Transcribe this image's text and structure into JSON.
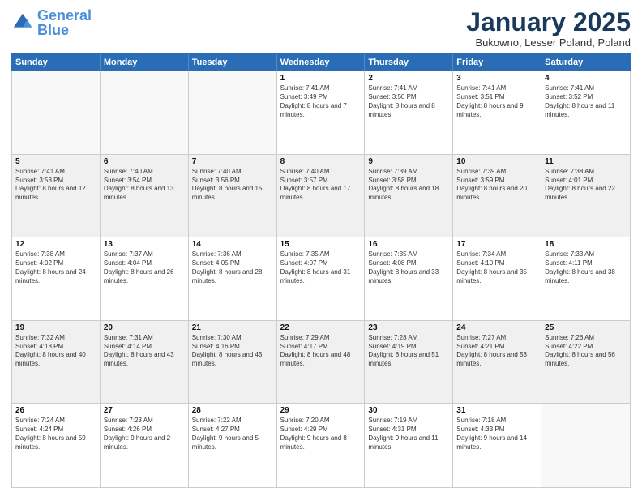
{
  "header": {
    "logo_general": "General",
    "logo_blue": "Blue",
    "month_title": "January 2025",
    "location": "Bukowno, Lesser Poland, Poland"
  },
  "days_of_week": [
    "Sunday",
    "Monday",
    "Tuesday",
    "Wednesday",
    "Thursday",
    "Friday",
    "Saturday"
  ],
  "weeks": [
    [
      {
        "day": "",
        "empty": true
      },
      {
        "day": "",
        "empty": true
      },
      {
        "day": "",
        "empty": true
      },
      {
        "day": "1",
        "sunrise": "7:41 AM",
        "sunset": "3:49 PM",
        "daylight": "8 hours and 7 minutes."
      },
      {
        "day": "2",
        "sunrise": "7:41 AM",
        "sunset": "3:50 PM",
        "daylight": "8 hours and 8 minutes."
      },
      {
        "day": "3",
        "sunrise": "7:41 AM",
        "sunset": "3:51 PM",
        "daylight": "8 hours and 9 minutes."
      },
      {
        "day": "4",
        "sunrise": "7:41 AM",
        "sunset": "3:52 PM",
        "daylight": "8 hours and 11 minutes."
      }
    ],
    [
      {
        "day": "5",
        "sunrise": "7:41 AM",
        "sunset": "3:53 PM",
        "daylight": "8 hours and 12 minutes."
      },
      {
        "day": "6",
        "sunrise": "7:40 AM",
        "sunset": "3:54 PM",
        "daylight": "8 hours and 13 minutes."
      },
      {
        "day": "7",
        "sunrise": "7:40 AM",
        "sunset": "3:56 PM",
        "daylight": "8 hours and 15 minutes."
      },
      {
        "day": "8",
        "sunrise": "7:40 AM",
        "sunset": "3:57 PM",
        "daylight": "8 hours and 17 minutes."
      },
      {
        "day": "9",
        "sunrise": "7:39 AM",
        "sunset": "3:58 PM",
        "daylight": "8 hours and 18 minutes."
      },
      {
        "day": "10",
        "sunrise": "7:39 AM",
        "sunset": "3:59 PM",
        "daylight": "8 hours and 20 minutes."
      },
      {
        "day": "11",
        "sunrise": "7:38 AM",
        "sunset": "4:01 PM",
        "daylight": "8 hours and 22 minutes."
      }
    ],
    [
      {
        "day": "12",
        "sunrise": "7:38 AM",
        "sunset": "4:02 PM",
        "daylight": "8 hours and 24 minutes."
      },
      {
        "day": "13",
        "sunrise": "7:37 AM",
        "sunset": "4:04 PM",
        "daylight": "8 hours and 26 minutes."
      },
      {
        "day": "14",
        "sunrise": "7:36 AM",
        "sunset": "4:05 PM",
        "daylight": "8 hours and 28 minutes."
      },
      {
        "day": "15",
        "sunrise": "7:35 AM",
        "sunset": "4:07 PM",
        "daylight": "8 hours and 31 minutes."
      },
      {
        "day": "16",
        "sunrise": "7:35 AM",
        "sunset": "4:08 PM",
        "daylight": "8 hours and 33 minutes."
      },
      {
        "day": "17",
        "sunrise": "7:34 AM",
        "sunset": "4:10 PM",
        "daylight": "8 hours and 35 minutes."
      },
      {
        "day": "18",
        "sunrise": "7:33 AM",
        "sunset": "4:11 PM",
        "daylight": "8 hours and 38 minutes."
      }
    ],
    [
      {
        "day": "19",
        "sunrise": "7:32 AM",
        "sunset": "4:13 PM",
        "daylight": "8 hours and 40 minutes."
      },
      {
        "day": "20",
        "sunrise": "7:31 AM",
        "sunset": "4:14 PM",
        "daylight": "8 hours and 43 minutes."
      },
      {
        "day": "21",
        "sunrise": "7:30 AM",
        "sunset": "4:16 PM",
        "daylight": "8 hours and 45 minutes."
      },
      {
        "day": "22",
        "sunrise": "7:29 AM",
        "sunset": "4:17 PM",
        "daylight": "8 hours and 48 minutes."
      },
      {
        "day": "23",
        "sunrise": "7:28 AM",
        "sunset": "4:19 PM",
        "daylight": "8 hours and 51 minutes."
      },
      {
        "day": "24",
        "sunrise": "7:27 AM",
        "sunset": "4:21 PM",
        "daylight": "8 hours and 53 minutes."
      },
      {
        "day": "25",
        "sunrise": "7:26 AM",
        "sunset": "4:22 PM",
        "daylight": "8 hours and 56 minutes."
      }
    ],
    [
      {
        "day": "26",
        "sunrise": "7:24 AM",
        "sunset": "4:24 PM",
        "daylight": "8 hours and 59 minutes."
      },
      {
        "day": "27",
        "sunrise": "7:23 AM",
        "sunset": "4:26 PM",
        "daylight": "9 hours and 2 minutes."
      },
      {
        "day": "28",
        "sunrise": "7:22 AM",
        "sunset": "4:27 PM",
        "daylight": "9 hours and 5 minutes."
      },
      {
        "day": "29",
        "sunrise": "7:20 AM",
        "sunset": "4:29 PM",
        "daylight": "9 hours and 8 minutes."
      },
      {
        "day": "30",
        "sunrise": "7:19 AM",
        "sunset": "4:31 PM",
        "daylight": "9 hours and 11 minutes."
      },
      {
        "day": "31",
        "sunrise": "7:18 AM",
        "sunset": "4:33 PM",
        "daylight": "9 hours and 14 minutes."
      },
      {
        "day": "",
        "empty": true
      }
    ]
  ]
}
